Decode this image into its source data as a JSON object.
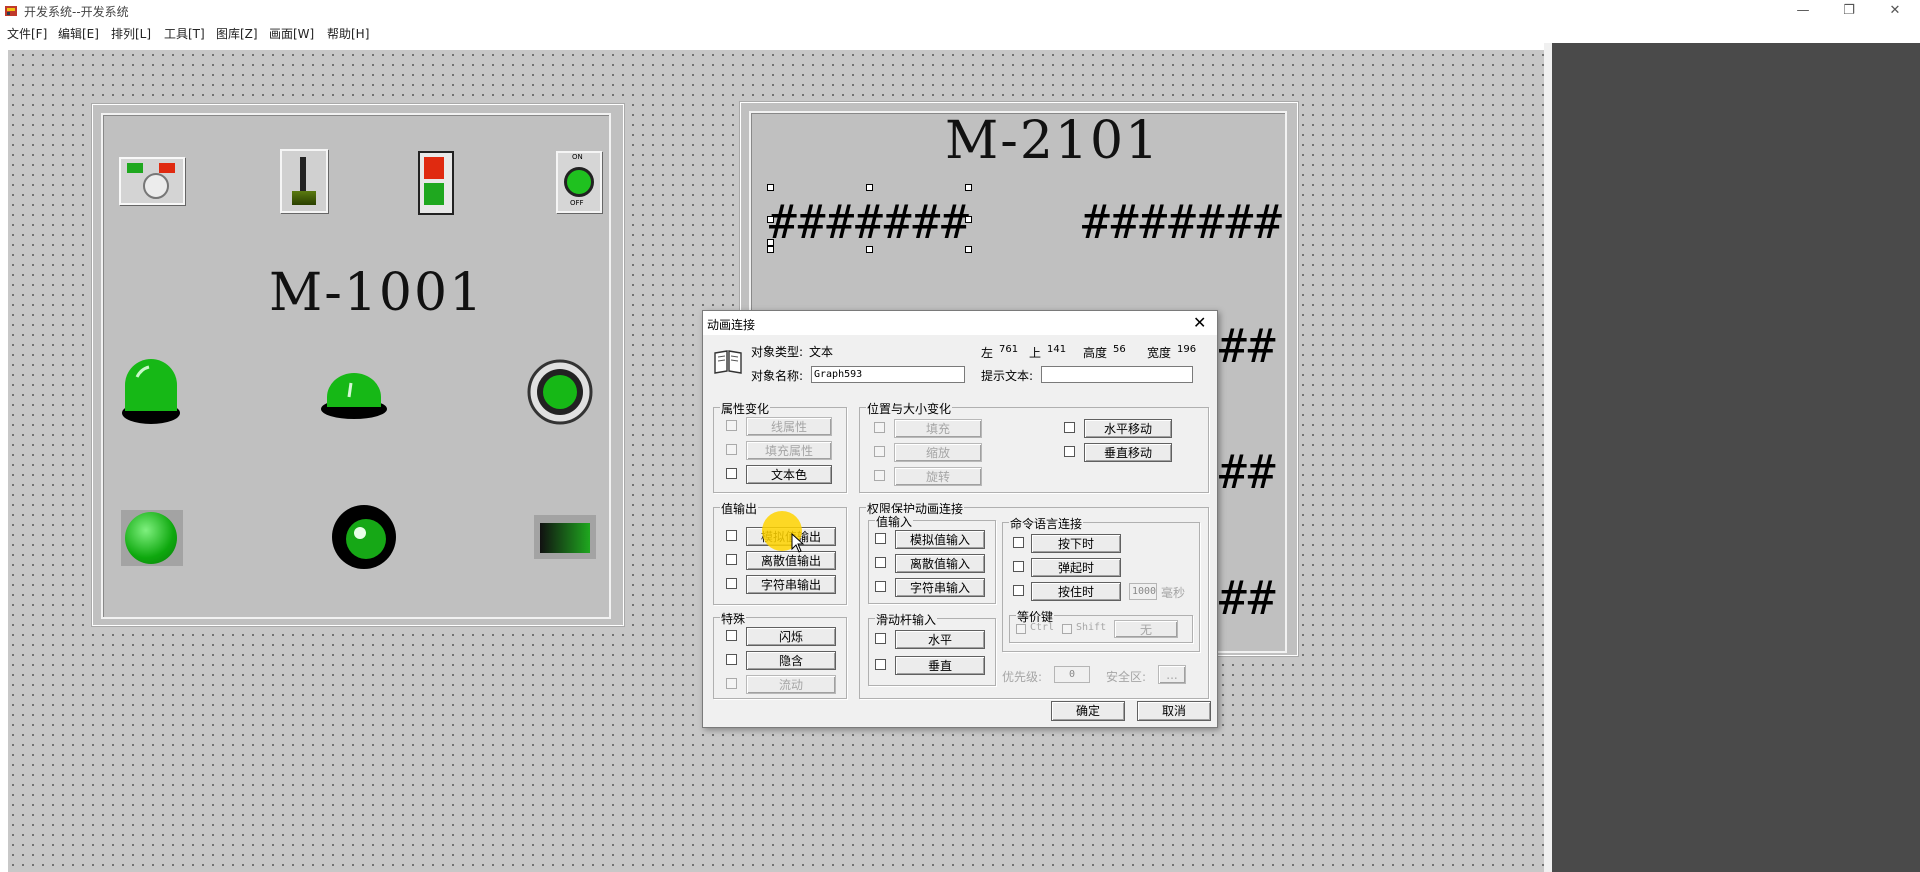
{
  "window": {
    "title": "开发系统--开发系统",
    "controls": {
      "minimize": "—",
      "maximize": "❐",
      "close": "✕"
    }
  },
  "menu": [
    "文件[F]",
    "编辑[E]",
    "排列[L]",
    "工具[T]",
    "图库[Z]",
    "画面[W]",
    "帮助[H]"
  ],
  "canvas": {
    "panel_left": {
      "label": "M-1001",
      "top_indicator_on": "ON",
      "top_indicator_off": "OFF"
    },
    "panel_right": {
      "label": "M-2101",
      "hash": "#######",
      "hash_short": "##"
    }
  },
  "colors": {
    "lamp_green": "#1fc11f",
    "switch_red": "#e02a10",
    "canvas": "#c8c8c8",
    "dark_panel": "#4a4a4a",
    "cursor_highlight": "#ffd400"
  },
  "dialog": {
    "title": "动画连接",
    "close": "✕",
    "object_type_label": "对象类型:",
    "object_type_value": "文本",
    "object_name_label": "对象名称:",
    "object_name_value": "Graph593",
    "left_label": "左",
    "left_value": "761",
    "top_label": "上",
    "top_value": "141",
    "height_label": "高度",
    "height_value": "56",
    "width_label": "宽度",
    "width_value": "196",
    "hint_label": "提示文本:",
    "hint_value": "",
    "attr_group": {
      "title": "属性变化",
      "items": [
        {
          "label": "线属性",
          "enabled": false
        },
        {
          "label": "填充属性",
          "enabled": false
        },
        {
          "label": "文本色",
          "enabled": true
        }
      ]
    },
    "pos_group": {
      "title": "位置与大小变化",
      "left_items": [
        {
          "label": "填充",
          "enabled": false
        },
        {
          "label": "缩放",
          "enabled": false
        },
        {
          "label": "旋转",
          "enabled": false
        }
      ],
      "right_items": [
        {
          "label": "水平移动",
          "enabled": true
        },
        {
          "label": "垂直移动",
          "enabled": true
        }
      ]
    },
    "value_out_group": {
      "title": "值输出",
      "items": [
        {
          "label": "模拟值输出",
          "enabled": true
        },
        {
          "label": "离散值输出",
          "enabled": true
        },
        {
          "label": "字符串输出",
          "enabled": true
        }
      ]
    },
    "special_group": {
      "title": "特殊",
      "items": [
        {
          "label": "闪烁",
          "enabled": true
        },
        {
          "label": "隐含",
          "enabled": true
        },
        {
          "label": "流动",
          "enabled": false
        }
      ]
    },
    "perm_group": {
      "title": "权限保护动画连接"
    },
    "value_in_group": {
      "title": "值输入",
      "items": [
        {
          "label": "模拟值输入",
          "enabled": true
        },
        {
          "label": "离散值输入",
          "enabled": true
        },
        {
          "label": "字符串输入",
          "enabled": true
        }
      ]
    },
    "slider_group": {
      "title": "滑动杆输入",
      "items": [
        {
          "label": "水平",
          "enabled": true
        },
        {
          "label": "垂直",
          "enabled": true
        }
      ]
    },
    "cmd_group": {
      "title": "命令语言连接",
      "items": [
        {
          "label": "按下时",
          "enabled": true
        },
        {
          "label": "弹起时",
          "enabled": true
        },
        {
          "label": "按住时",
          "enabled": true
        }
      ],
      "interval_value": "1000",
      "interval_unit": "毫秒"
    },
    "hotkey_group": {
      "title": "等价键",
      "ctrl": "Ctrl",
      "shift": "Shift",
      "key_value": "无"
    },
    "priority_label": "优先级:",
    "priority_value": "0",
    "safe_zone_label": "安全区:",
    "safe_zone_button": "...",
    "ok": "确定",
    "cancel": "取消"
  }
}
